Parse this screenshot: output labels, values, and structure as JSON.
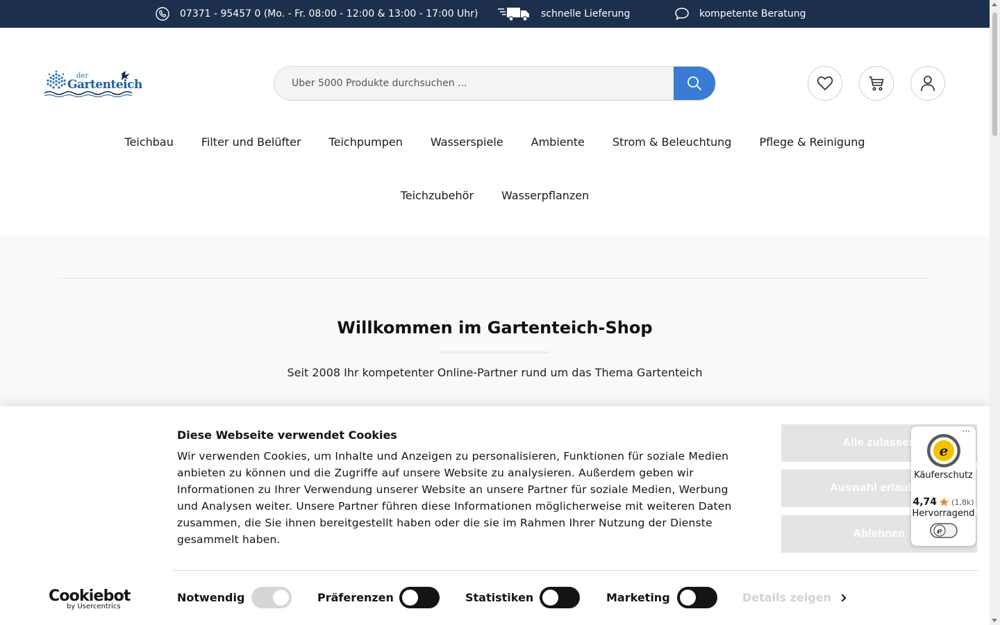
{
  "topbar": {
    "phone_text": "07371 - 95457 0 (Mo. - Fr. 08:00 - 12:00 & 13:00 - 17:00 Uhr)",
    "delivery_text": "schnelle Lieferung",
    "advice_text": "kompetente Beratung",
    "background_color": "#1c2f4d"
  },
  "header": {
    "logo_small": "der",
    "logo_main": "Gartenteich",
    "search_placeholder": "Über 5000 Produkte durchsuchen ...",
    "accent_color": "#3a7bd5",
    "icons": [
      "heart-icon",
      "cart-icon",
      "user-icon"
    ]
  },
  "nav": {
    "row1": [
      "Teichbau",
      "Filter und Belüfter",
      "Teichpumpen",
      "Wasserspiele",
      "Ambiente",
      "Strom & Beleuchtung",
      "Pflege & Reinigung"
    ],
    "row2": [
      "Teichzubehör",
      "Wasserpflanzen"
    ]
  },
  "content": {
    "welcome_title": "Willkommen im Gartenteich-Shop",
    "welcome_subtitle": "Seit 2008 Ihr kompetenter Online-Partner rund um das Thema Gartenteich"
  },
  "cookie": {
    "title": "Diese Webseite verwendet Cookies",
    "text": "Wir verwenden Cookies, um Inhalte und Anzeigen zu personalisieren, Funktionen für soziale Medien anbieten zu können und die Zugriffe auf unsere Website zu analysieren. Außerdem geben wir Informationen zu Ihrer Verwendung unserer Website an unsere Partner für soziale Medien, Werbung und Analysen weiter. Unsere Partner führen diese Informationen möglicherweise mit weiteren Daten zusammen, die Sie ihnen bereitgestellt haben oder die sie im Rahmen Ihrer Nutzung der Dienste gesammelt haben.",
    "btn_allow_all": "Alle zulassen",
    "btn_allow_selection": "Auswahl erlauben",
    "btn_reject": "Ablehnen",
    "logo_main": "Cookiebot",
    "logo_sub": "by Usercentrics",
    "categories": [
      {
        "label": "Notwendig",
        "enabled": true,
        "locked": true
      },
      {
        "label": "Präferenzen",
        "enabled": false
      },
      {
        "label": "Statistiken",
        "enabled": false
      },
      {
        "label": "Marketing",
        "enabled": false
      }
    ],
    "details_label": "Details zeigen"
  },
  "trusted_shops": {
    "menu": "···",
    "label": "Käuferschutz",
    "score": "4,74",
    "count": "(1,8k)",
    "grade": "Hervorragend",
    "star_color": "#e98a2c"
  }
}
